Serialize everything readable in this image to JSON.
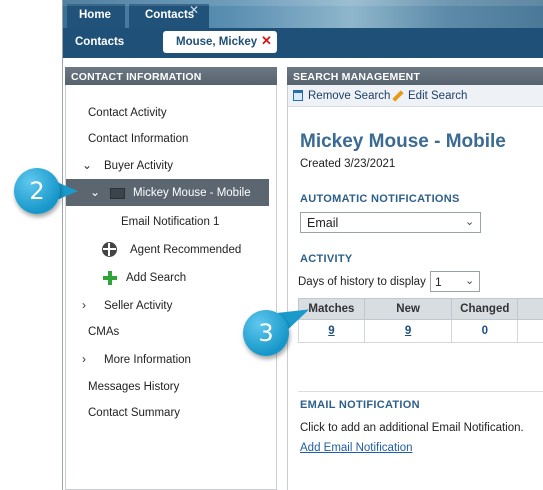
{
  "tabs": {
    "home": "Home",
    "contacts": "Contacts",
    "close_symbol": "✕"
  },
  "subbar": {
    "section": "Contacts",
    "contact_chip": "Mouse, Mickey",
    "chip_close": "✕"
  },
  "left_panel": {
    "title": "CONTACT INFORMATION",
    "items": {
      "contact_activity": "Contact Activity",
      "contact_information": "Contact Information",
      "buyer_activity": "Buyer Activity",
      "selected_search": "Mickey Mouse - Mobile",
      "email_notification_1": "Email Notification 1",
      "agent_recommended": "Agent Recommended",
      "add_search": "Add Search",
      "seller_activity": "Seller Activity",
      "cmas": "CMAs",
      "more_information": "More Information",
      "messages_history": "Messages History",
      "contact_summary": "Contact Summary"
    }
  },
  "right_panel": {
    "title": "SEARCH MANAGEMENT",
    "toolbar": {
      "remove_search": "Remove Search",
      "edit_search": "Edit Search"
    },
    "search_title": "Mickey Mouse - Mobile",
    "created": "Created 3/23/2021",
    "automatic_notifications": {
      "heading": "AUTOMATIC NOTIFICATIONS",
      "selected": "Email"
    },
    "activity": {
      "heading": "ACTIVITY",
      "history_label": "Days of history to display",
      "history_value": "1",
      "columns": [
        "Matches",
        "New",
        "Changed"
      ],
      "values": [
        "9",
        "9",
        "0"
      ]
    },
    "email_notification": {
      "heading": "EMAIL NOTIFICATION",
      "text": "Click to add an additional Email Notification.",
      "link": "Add Email Notification"
    }
  },
  "callouts": {
    "step_2": "2",
    "step_3": "3"
  },
  "colors": {
    "header_navy": "#1f5077",
    "panel_header": "#5f6b76",
    "selected_row": "#5b6670",
    "title_blue": "#3b6b92",
    "callout_blue": "#1797c9",
    "close_red": "#d11b1b"
  }
}
